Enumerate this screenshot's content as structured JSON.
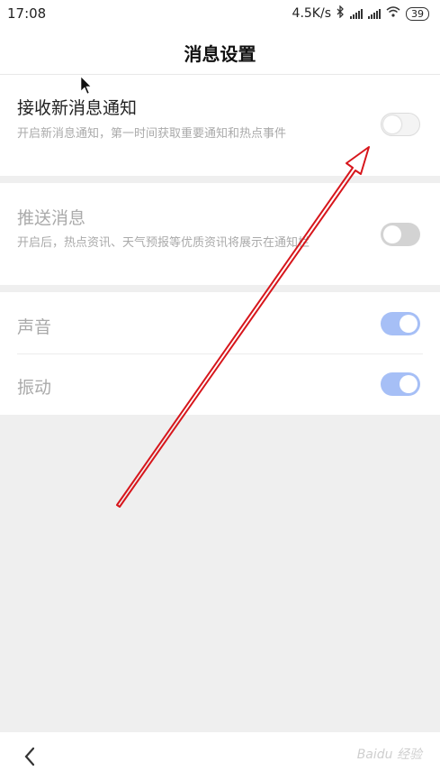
{
  "status_bar": {
    "time": "17:08",
    "net_speed": "4.5K/s",
    "battery": "39"
  },
  "header": {
    "title": "消息设置"
  },
  "settings": {
    "receive": {
      "title": "接收新消息通知",
      "desc": "开启新消息通知，第一时间获取重要通知和热点事件",
      "enabled": false
    },
    "push": {
      "title": "推送消息",
      "desc": "开启后，热点资讯、天气预报等优质资讯将展示在通知栏",
      "enabled": false
    },
    "sound": {
      "title": "声音",
      "enabled": true
    },
    "vibrate": {
      "title": "振动",
      "enabled": true
    }
  },
  "bottom": {
    "watermark": "Baidu 经验"
  },
  "colors": {
    "toggle_on": "#a6bff6",
    "annotation_arrow": "#d7161c"
  }
}
